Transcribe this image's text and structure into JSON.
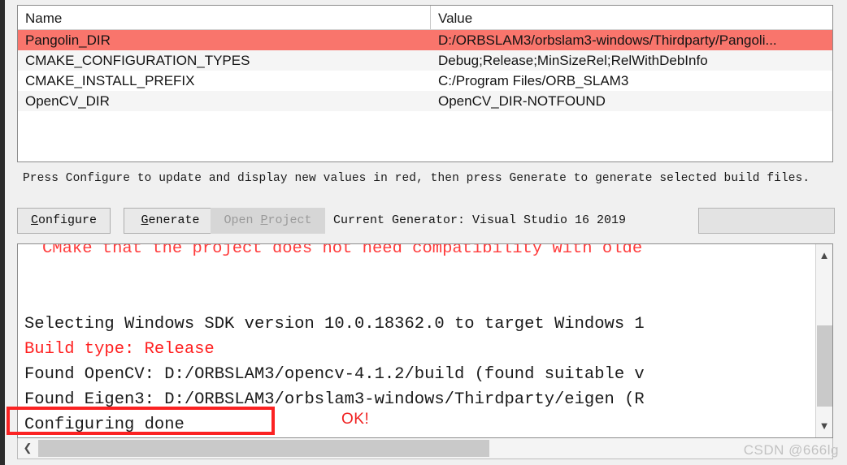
{
  "cache_table": {
    "columns": [
      "Name",
      "Value"
    ],
    "rows": [
      {
        "name": "Pangolin_DIR",
        "value": "D:/ORBSLAM3/orbslam3-windows/Thirdparty/Pangoli...",
        "state": "selected"
      },
      {
        "name": "CMAKE_CONFIGURATION_TYPES",
        "value": "Debug;Release;MinSizeRel;RelWithDebInfo",
        "state": "alt"
      },
      {
        "name": "CMAKE_INSTALL_PREFIX",
        "value": "C:/Program Files/ORB_SLAM3",
        "state": "normal"
      },
      {
        "name": "OpenCV_DIR",
        "value": "OpenCV_DIR-NOTFOUND",
        "state": "alt"
      }
    ],
    "selected_row_color": "#f9756c",
    "alt_row_color": "#f5f5f5"
  },
  "hint": "Press Configure to update and display new values in red, then press Generate to generate selected build files.",
  "toolbar": {
    "configure": {
      "accel": "C",
      "rest": "onfigure"
    },
    "generate": {
      "accel": "G",
      "rest": "enerate"
    },
    "open_project": {
      "pre": "Open ",
      "accel": "P",
      "rest": "roject",
      "disabled": true
    },
    "generator_label": "Current Generator: Visual Studio 16 2019",
    "progress_value": ""
  },
  "log": {
    "lines": [
      {
        "text": "CMake that the project does not need compatibility with olde",
        "color": "red",
        "clipped": true
      },
      {
        "text": "",
        "color": "black"
      },
      {
        "text": "",
        "color": "black"
      },
      {
        "text": "Selecting Windows SDK version 10.0.18362.0 to target Windows 1",
        "color": "black"
      },
      {
        "text": "Build type: Release",
        "color": "red"
      },
      {
        "text": "Found OpenCV: D:/ORBSLAM3/opencv-4.1.2/build (found suitable v",
        "color": "black"
      },
      {
        "text": "Found Eigen3: D:/ORBSLAM3/orbslam3-windows/Thirdparty/eigen (R",
        "color": "black"
      },
      {
        "text": "Configuring done",
        "color": "black"
      }
    ],
    "scroll_up_icon": "chevron-up",
    "scroll_down_icon": "chevron-down",
    "scroll_left_icon": "chevron-left"
  },
  "annotations": {
    "ok_label": "OK!",
    "box_color": "#fb2222"
  },
  "watermark": "CSDN @666lg"
}
